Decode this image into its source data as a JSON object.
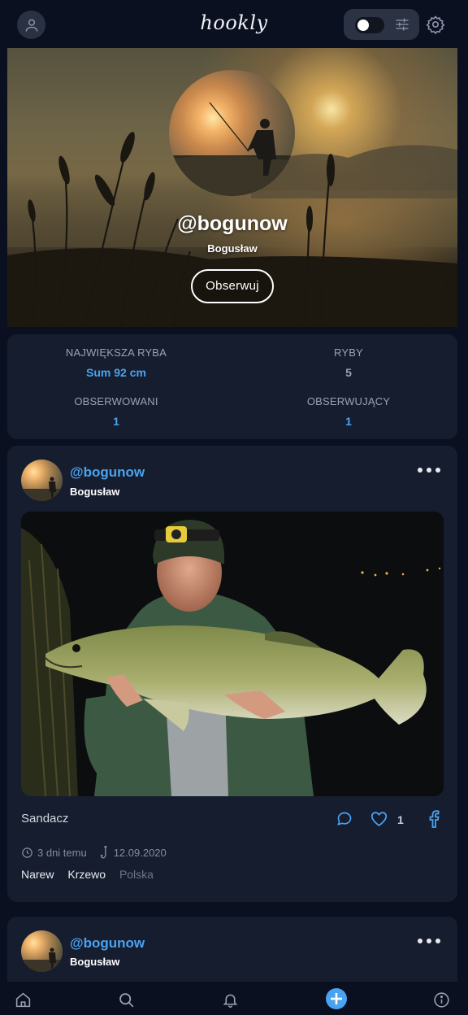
{
  "app": {
    "logo": "hookly"
  },
  "header": {
    "profile_icon": "user-icon",
    "toggle_state": "off",
    "filter_icon": "sliders-icon",
    "settings_icon": "gear-icon"
  },
  "profile": {
    "username": "@bogunow",
    "name": "Bogusław",
    "follow_label": "Obserwuj"
  },
  "stats": {
    "biggest_fish_label": "NAJWIĘKSZA RYBA",
    "biggest_fish_value": "Sum 92 cm",
    "fish_label": "RYBY",
    "fish_value": "5",
    "following_label": "OBSERWOWANI",
    "following_value": "1",
    "followers_label": "OBSERWUJĄCY",
    "followers_value": "1"
  },
  "posts": [
    {
      "username": "@bogunow",
      "name": "Bogusław",
      "species": "Sandacz",
      "likes": "1",
      "time_ago": "3 dni temu",
      "catch_date": "12.09.2020",
      "places": [
        "Narew",
        "Krzewo"
      ],
      "country": "Polska"
    },
    {
      "username": "@bogunow",
      "name": "Bogusław"
    }
  ],
  "nav": {
    "home_icon": "home-icon",
    "search_icon": "search-icon",
    "notifications_icon": "bell-icon",
    "add_icon": "plus-circle-icon",
    "info_icon": "info-icon"
  },
  "colors": {
    "background": "#0b1020",
    "card": "#161d2e",
    "accent": "#4aa3f0"
  }
}
